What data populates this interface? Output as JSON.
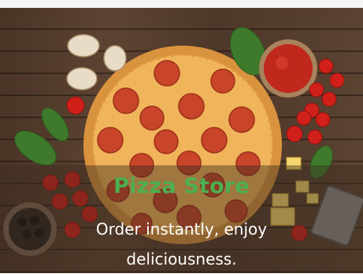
{
  "hero": {
    "title": "Pizza Store",
    "tagline": "Order instantly, enjoy deliciousness.",
    "image_subject": "pepperoni-pizza-on-wooden-table",
    "colors": {
      "title": "#4caf50",
      "tagline": "#ffffff",
      "wood": "#4e3829",
      "sauce": "#c0281c",
      "pepperoni": "#c8452a"
    }
  }
}
